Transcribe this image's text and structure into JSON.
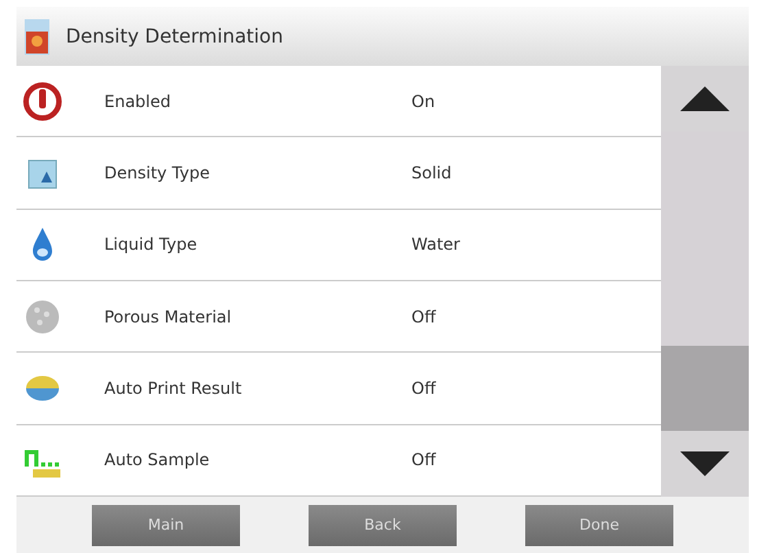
{
  "window": {
    "title": "Density Determination"
  },
  "settings": [
    {
      "kind": "power",
      "label": "Enabled",
      "value": "On"
    },
    {
      "kind": "cube",
      "label": "Density Type",
      "value": "Solid"
    },
    {
      "kind": "drop",
      "label": "Liquid Type",
      "value": "Water"
    },
    {
      "kind": "sphere",
      "label": "Porous Material",
      "value": "Off"
    },
    {
      "kind": "printer",
      "label": "Auto Print Result",
      "value": "Off"
    },
    {
      "kind": "auto",
      "label": "Auto Sample",
      "value": "Off"
    }
  ],
  "buttons": [
    "Main",
    "Back",
    "Done"
  ]
}
